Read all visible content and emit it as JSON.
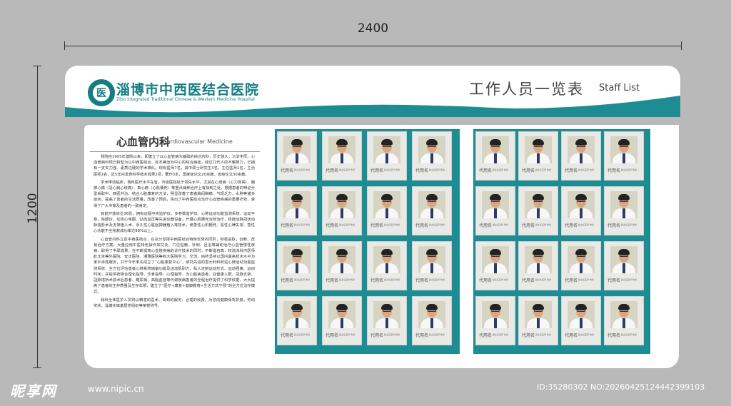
{
  "dimensions": {
    "width": "2400",
    "height": "1200"
  },
  "header": {
    "hospital_name": "淄博市中西医结合医院",
    "hospital_name_en": "Zibo Integrated Traditional Chinese & Western Medicine Hospital",
    "list_title": "工作人员一览表",
    "list_title_en": "Staff List",
    "logo_glyph": "医"
  },
  "department": {
    "name": "心血管内科",
    "name_en": "Cardiovascular Medicine",
    "paragraphs": [
      "我院自1905年建院以来，即建立了以心血管病为基础的综合内科，历史悠久，沉淀丰厚。心血管病科现已转型为以中西医结合、标本兼治为中心的综合病症，经过几代人的不懈努力，已拥有一支实力强、素质过硬的学术梯队。现有医师7名，其中硕士研究生3名，主任医师1名，主治医师2名，近5年内发表科学技术成果2项，著作3本，国家级论文20余篇，省级论文30余篇。",
      "学术带动临床，我科医疗水平在省、市级医院处于领先水平，尤其在心衰病（心力衰竭）、胸痹心痛（冠心病心绞痛）、真心痛（心肌梗死）等重点病种治疗上有独到之处，根据患者的辨证分型采取中、西医并治、结合心脏康复的方法，明显改善了患者胸闷胸痛、气短乏力、水肿等诸多症状，提高了患者的生活质量，改善了预后，突出了中西医结合治疗心血管疾病的重要疗效，获得了广大专家及患者的一致肯定。",
      "目前开放床位36张，拥有运程中央监护仪、多参数监护仪、心肺运动功能监测系统、运动平板、除颤仪、动态心电图、动态血压等先进仪器设备，开展心肌梗死溶栓治疗，经桡动脉冠状动脉造影术及支架植入术、永久性心脏起搏器植入等技术，使急性心肌梗死、恶性心律失常、急性心功能不全抢救成功率达98%以上。",
      "心血管内科立足中西医结合，在充分发挥中西医结合特色优势的同时，积极进取，创新，改良治疗方案，大量应用中医特色操作如艾灸、穴位贴敷、针刺、足浴等辅助治疗心血管慢性疾病，取得了丰硕成果。在不断提高心血管疾病的诊疗技术的同时，不断倡自真，较流派科内医师赴北京等外医院、安贞医院、湘雅医院等有大医院学习、交流，始终坚持以国内最高技术水平为家乡百姓服务，并于今年率先成立了“心脏康复中心”，依托先进的意大利科利进心肺运动功能监测系统，全方位评估患者心肺系统储备功能及运动肌耐力，私人定制运动形式、运动强度、运动时间，并提供药物合理化指导、饮食指导、心理指导、为心脏病患者、亚健康人群、冠脉支架、冠脉搭桥术前术后患者、糖尿病、高脂血症等代谢疾病患者的全程治疗提供了科学依据，大大提高了患者的生存质量及生存年限，建立了“医疗+康复+健康教育+生活方式干预”的全方位治疗模式。",
      "我科全体医护人员将以精湛的医术、周到的服务、合理的收费、为您的健康保驾护航。劳动奖状、淄博先锋基层党组织等荣誉称号。"
    ]
  },
  "staff": {
    "name_placeholder": "代用名",
    "title_placeholder": "副主任医师 教授",
    "groups": [
      {
        "id": "left-group",
        "rows": 4,
        "cols": 4
      },
      {
        "id": "right-group",
        "rows": 4,
        "cols": 4
      }
    ]
  },
  "watermark": {
    "site": "昵享网",
    "url": "www.nipic.cn",
    "id_text": "ID:35280302 NO:20260425124442399103"
  },
  "colors": {
    "accent": "#1d8c93",
    "brand": "#147e83",
    "background": "#b9b9b9"
  }
}
